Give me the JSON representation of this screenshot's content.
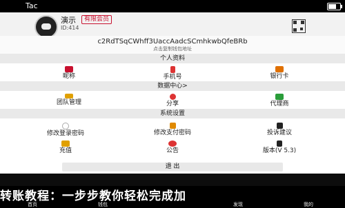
{
  "status_bar": {
    "carrier": "Tac"
  },
  "profile": {
    "name": "演示",
    "badge": "有限会员",
    "uid": "ID:414",
    "address": "c2RdTSqCWhff3UaccAadcSCmhkwbQfeBRb",
    "address_hint": "点击复制钱包地址"
  },
  "sections": {
    "personal": {
      "title": "个人资料",
      "items": [
        {
          "label": "昵称",
          "icon": "id-card-icon",
          "color": "#c8102e"
        },
        {
          "label": "手机号",
          "icon": "phone-icon",
          "color": "#d33"
        },
        {
          "label": "银行卡",
          "icon": "bank-card-icon",
          "color": "#e07000"
        }
      ]
    },
    "data": {
      "title": "数据中心>",
      "items": [
        {
          "label": "团队管理",
          "icon": "crown-icon",
          "color": "#e0a000"
        },
        {
          "label": "分享",
          "icon": "share-icon",
          "color": "#d33"
        },
        {
          "label": "代理商",
          "icon": "agent-icon",
          "color": "#2a9d3a"
        }
      ]
    },
    "settings": {
      "title": "系统设置",
      "items": [
        {
          "label": "修改登录密码",
          "icon": "lock-icon",
          "color": "#aaa"
        },
        {
          "label": "修改支付密码",
          "icon": "key-icon",
          "color": "#e08a00"
        },
        {
          "label": "投诉建议",
          "icon": "feedback-icon",
          "color": "#222"
        },
        {
          "label": "充值",
          "icon": "wallet-icon",
          "color": "#e0a000"
        },
        {
          "label": "公告",
          "icon": "megaphone-icon",
          "color": "#d33"
        },
        {
          "label": "版本(V 5.3)",
          "icon": "version-icon",
          "color": "#222"
        }
      ]
    }
  },
  "logout_label": "退  出",
  "banner_text": "转账教程：一步步教你轻松完成加",
  "tabs": [
    "首页",
    "钱包",
    "",
    "发现",
    "我的"
  ]
}
